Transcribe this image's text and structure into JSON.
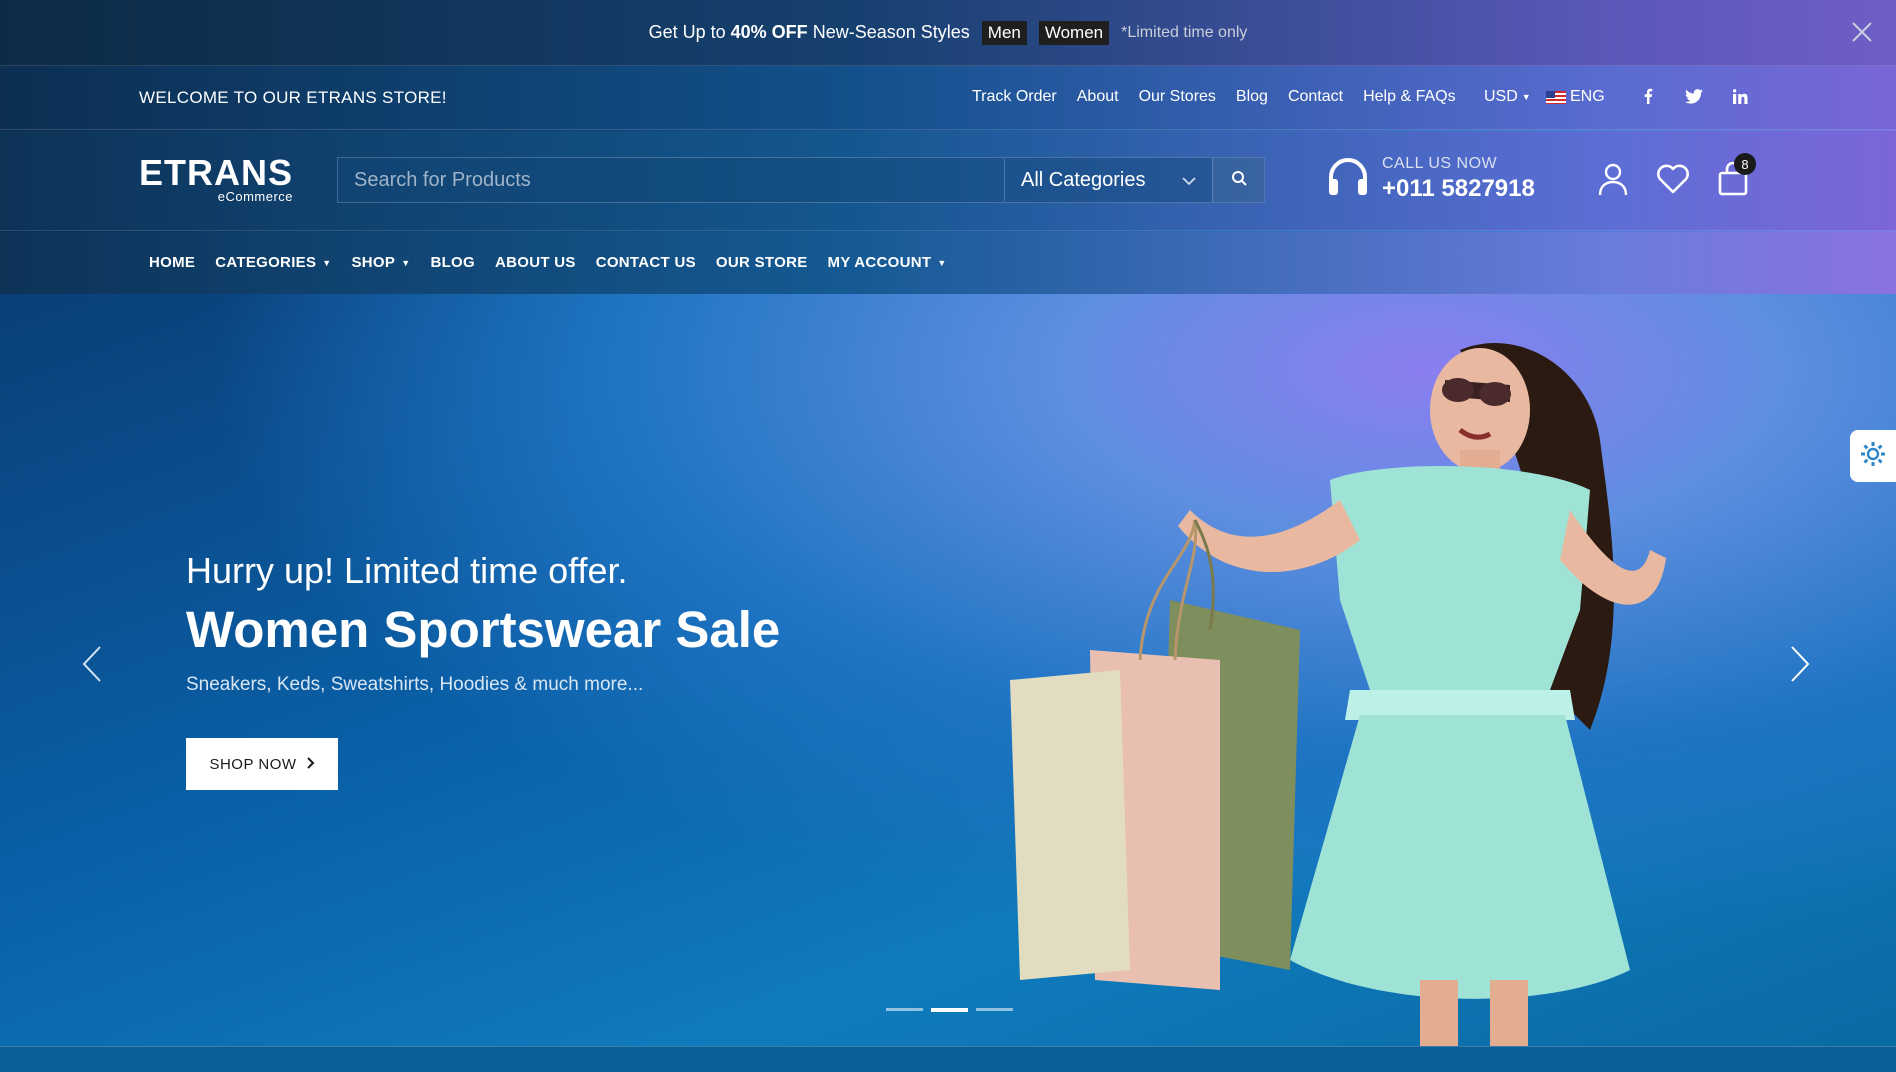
{
  "announcement": {
    "pre_text": "Get Up to",
    "highlight": "40% OFF",
    "post_text": "New-Season Styles",
    "tag_men": "Men",
    "tag_women": "Women",
    "note": "*Limited time only"
  },
  "topbar": {
    "welcome": "WELCOME TO OUR ETRANS STORE!",
    "links": [
      "Track Order",
      "About",
      "Our Stores",
      "Blog",
      "Contact",
      "Help & FAQs"
    ],
    "currency": "USD",
    "language": "ENG",
    "social": [
      "facebook-icon",
      "twitter-icon",
      "linkedin-icon"
    ]
  },
  "header": {
    "logo_main": "ETRANS",
    "logo_sub": "eCommerce",
    "search_placeholder": "Search for Products",
    "category_selected": "All Categories",
    "call_label": "CALL US NOW",
    "call_number": "+011 5827918",
    "cart_count": "8"
  },
  "nav": {
    "items": [
      {
        "label": "HOME",
        "has_dropdown": false
      },
      {
        "label": "CATEGORIES",
        "has_dropdown": true
      },
      {
        "label": "SHOP",
        "has_dropdown": true
      },
      {
        "label": "BLOG",
        "has_dropdown": false
      },
      {
        "label": "ABOUT US",
        "has_dropdown": false
      },
      {
        "label": "CONTACT US",
        "has_dropdown": false
      },
      {
        "label": "OUR STORE",
        "has_dropdown": false
      },
      {
        "label": "MY ACCOUNT",
        "has_dropdown": true
      }
    ]
  },
  "hero": {
    "subtitle": "Hurry up! Limited time offer.",
    "title": "Women Sportswear Sale",
    "description": "Sneakers, Keds, Sweatshirts, Hoodies & much more...",
    "button_label": "SHOP NOW",
    "slide_count": 3,
    "active_slide": 2
  },
  "colors": {
    "accent_dark": "#1a1a1a",
    "hero_blue": "#0f7bbd",
    "hero_purple": "#8a79ee"
  }
}
